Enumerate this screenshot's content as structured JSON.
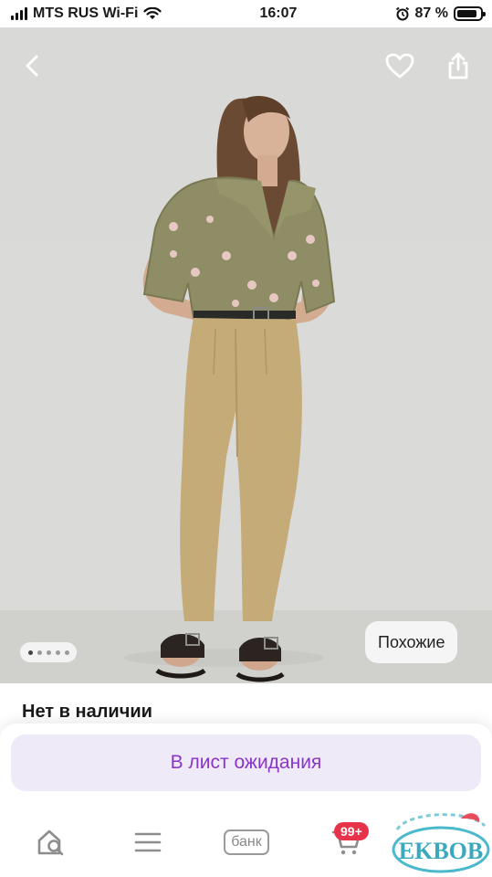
{
  "status_bar": {
    "carrier": "MTS RUS Wi-Fi",
    "time": "16:07",
    "battery_text": "87 %",
    "battery_level": 0.87
  },
  "photo": {
    "pager": {
      "count": 5,
      "active_index": 0
    },
    "similar_label": "Похожие"
  },
  "product": {
    "availability": "Нет в наличии"
  },
  "actions": {
    "waitlist_label": "В лист ожидания"
  },
  "tabbar": {
    "bank_label": "банк",
    "cart_badge": "99+"
  },
  "watermark": {
    "text": "EKBOB"
  },
  "colors": {
    "accent": "#8a35c9",
    "button_bg": "#efeaf8",
    "badge": "#e6334a"
  }
}
